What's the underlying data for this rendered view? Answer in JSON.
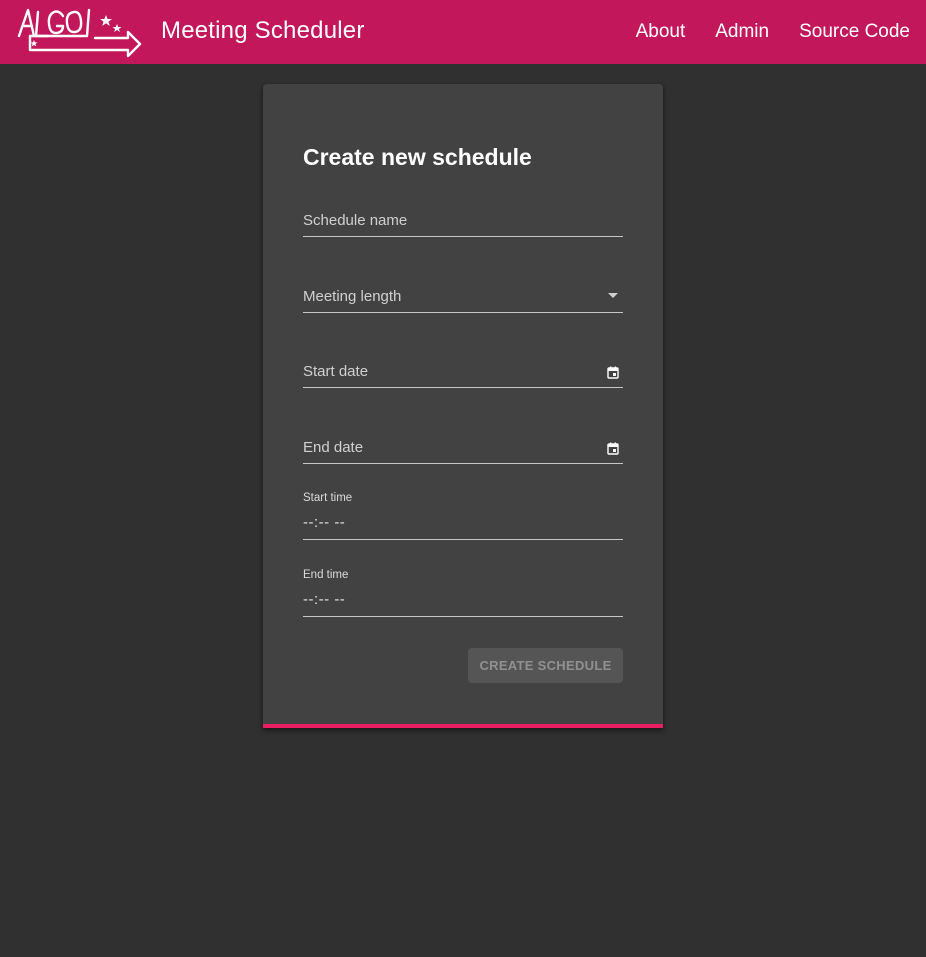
{
  "header": {
    "logo_text": "ALGOL",
    "app_title": "Meeting Scheduler",
    "nav": [
      {
        "label": "About"
      },
      {
        "label": "Admin"
      },
      {
        "label": "Source Code"
      }
    ]
  },
  "form": {
    "title": "Create new schedule",
    "schedule_name": {
      "label": "Schedule name",
      "value": ""
    },
    "meeting_length": {
      "label": "Meeting length",
      "value": "",
      "icon": "arrow-drop-down-icon"
    },
    "start_date": {
      "label": "Start date",
      "value": "",
      "icon": "calendar-icon"
    },
    "end_date": {
      "label": "End date",
      "value": "",
      "icon": "calendar-icon"
    },
    "start_time": {
      "label": "Start time",
      "value": "--:-- --"
    },
    "end_time": {
      "label": "End time",
      "value": "--:-- --"
    },
    "submit_label": "CREATE SCHEDULE"
  },
  "colors": {
    "toolbar": "#c2185b",
    "accent": "#e91e63",
    "background": "#303030",
    "card": "#424242"
  }
}
